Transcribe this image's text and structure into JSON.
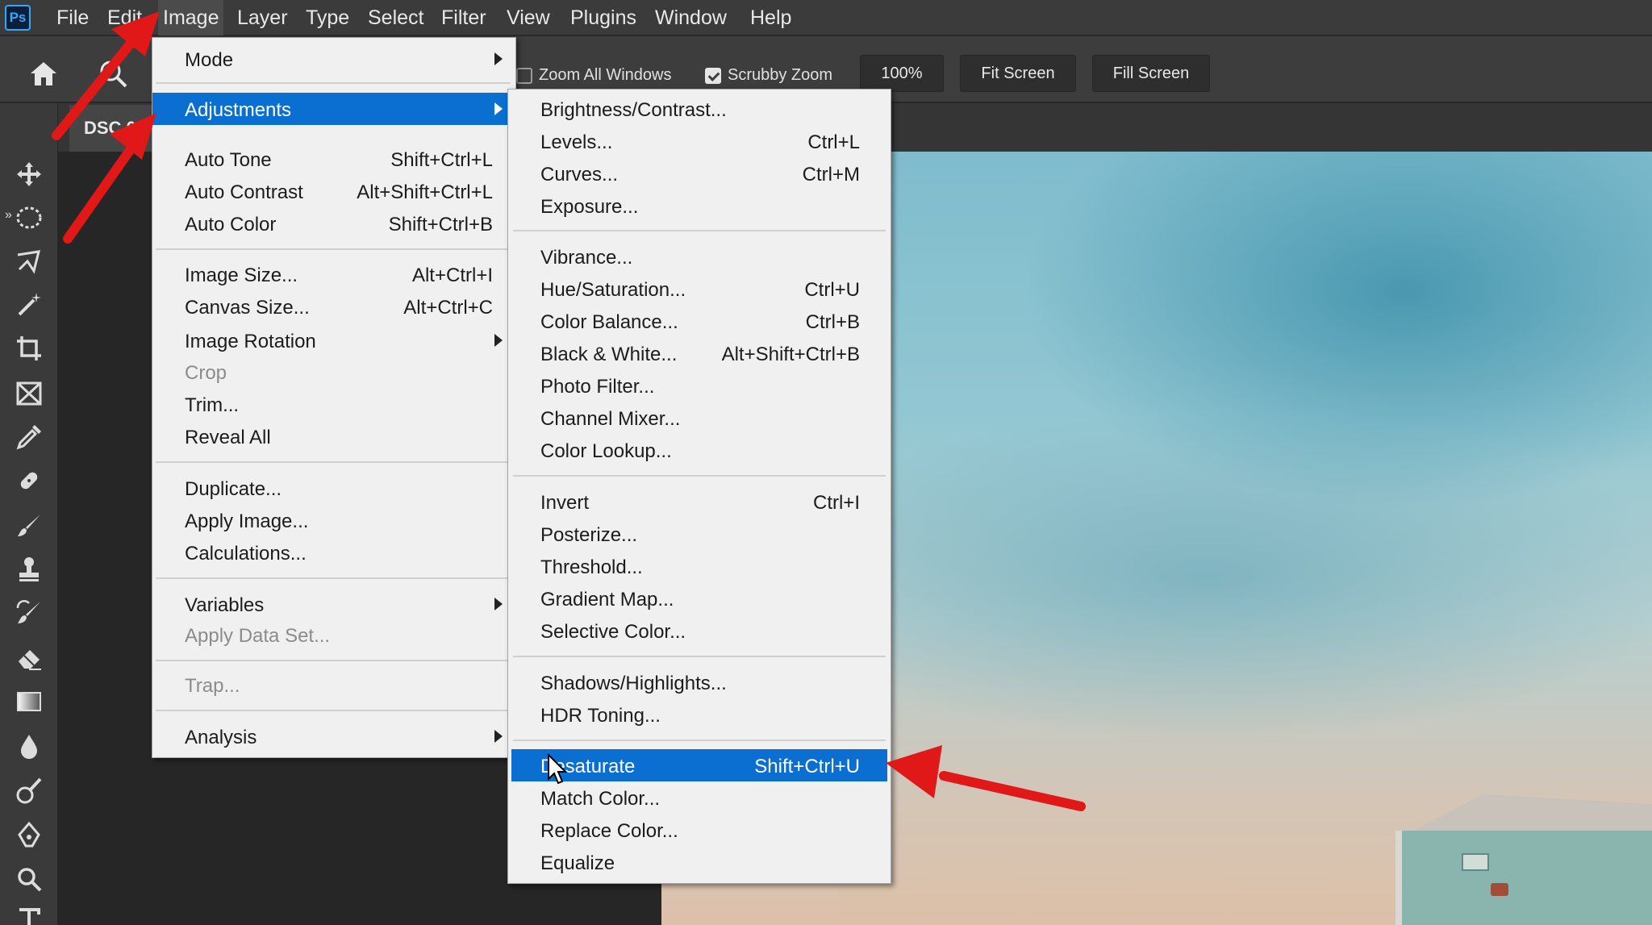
{
  "app": {
    "logo": "Ps"
  },
  "menubar": [
    "File",
    "Edit",
    "Image",
    "Layer",
    "Type",
    "Select",
    "Filter",
    "View",
    "Plugins",
    "Window",
    "Help"
  ],
  "options": {
    "zoom_all_windows": "Zoom All Windows",
    "scrubby_zoom": "Scrubby Zoom",
    "zoom_value": "100%",
    "fit_screen": "Fit Screen",
    "fill_screen": "Fill Screen"
  },
  "document": {
    "tab_label": "DSC 0"
  },
  "image_menu": {
    "mode": "Mode",
    "adjustments": "Adjustments",
    "auto_tone": {
      "label": "Auto Tone",
      "shortcut": "Shift+Ctrl+L"
    },
    "auto_contrast": {
      "label": "Auto Contrast",
      "shortcut": "Alt+Shift+Ctrl+L"
    },
    "auto_color": {
      "label": "Auto Color",
      "shortcut": "Shift+Ctrl+B"
    },
    "image_size": {
      "label": "Image Size...",
      "shortcut": "Alt+Ctrl+I"
    },
    "canvas_size": {
      "label": "Canvas Size...",
      "shortcut": "Alt+Ctrl+C"
    },
    "image_rotation": "Image Rotation",
    "crop": "Crop",
    "trim": "Trim...",
    "reveal_all": "Reveal All",
    "duplicate": "Duplicate...",
    "apply_image": "Apply Image...",
    "calculations": "Calculations...",
    "variables": "Variables",
    "apply_data_set": "Apply Data Set...",
    "trap": "Trap...",
    "analysis": "Analysis"
  },
  "adjustments_menu": {
    "brightness_contrast": {
      "label": "Brightness/Contrast...",
      "shortcut": ""
    },
    "levels": {
      "label": "Levels...",
      "shortcut": "Ctrl+L"
    },
    "curves": {
      "label": "Curves...",
      "shortcut": "Ctrl+M"
    },
    "exposure": {
      "label": "Exposure...",
      "shortcut": ""
    },
    "vibrance": {
      "label": "Vibrance...",
      "shortcut": ""
    },
    "hue_saturation": {
      "label": "Hue/Saturation...",
      "shortcut": "Ctrl+U"
    },
    "color_balance": {
      "label": "Color Balance...",
      "shortcut": "Ctrl+B"
    },
    "black_white": {
      "label": "Black & White...",
      "shortcut": "Alt+Shift+Ctrl+B"
    },
    "photo_filter": {
      "label": "Photo Filter...",
      "shortcut": ""
    },
    "channel_mixer": {
      "label": "Channel Mixer...",
      "shortcut": ""
    },
    "color_lookup": {
      "label": "Color Lookup...",
      "shortcut": ""
    },
    "invert": {
      "label": "Invert",
      "shortcut": "Ctrl+I"
    },
    "posterize": {
      "label": "Posterize...",
      "shortcut": ""
    },
    "threshold": {
      "label": "Threshold...",
      "shortcut": ""
    },
    "gradient_map": {
      "label": "Gradient Map...",
      "shortcut": ""
    },
    "selective_color": {
      "label": "Selective Color...",
      "shortcut": ""
    },
    "shadows_highlights": {
      "label": "Shadows/Highlights...",
      "shortcut": ""
    },
    "hdr_toning": {
      "label": "HDR Toning...",
      "shortcut": ""
    },
    "desaturate": {
      "label": "Desaturate",
      "shortcut": "Shift+Ctrl+U"
    },
    "match_color": {
      "label": "Match Color...",
      "shortcut": ""
    },
    "replace_color": {
      "label": "Replace Color...",
      "shortcut": ""
    },
    "equalize": {
      "label": "Equalize",
      "shortcut": ""
    }
  },
  "colors": {
    "highlight": "#0a6fd1",
    "menu_bg": "#f0f0f0",
    "arrow": "#e01818"
  }
}
